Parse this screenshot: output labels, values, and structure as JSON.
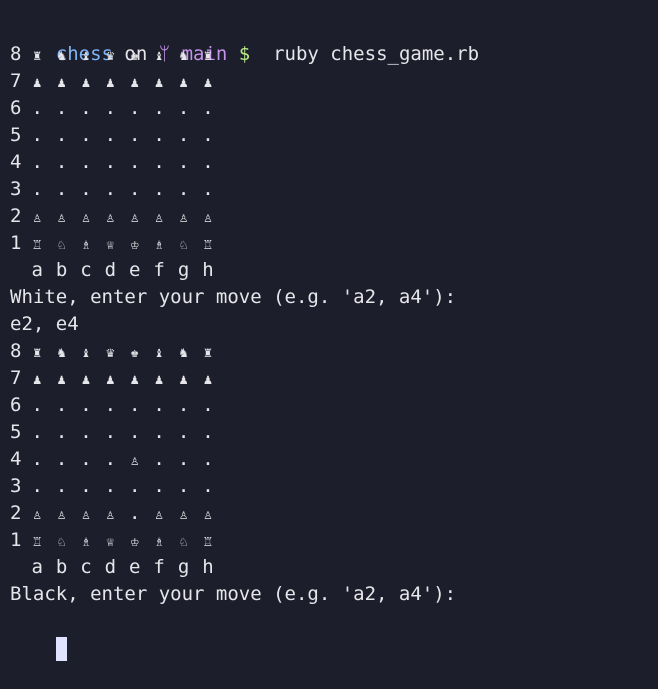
{
  "colors": {
    "background": "#1d1e2c",
    "text": "#e6e6ea",
    "prompt_dir": "#7fb4f5",
    "prompt_branch": "#c792ea",
    "prompt_symbol": "#b8e986",
    "cursor": "#dfe3ff"
  },
  "prompt": {
    "dir": "chess",
    "on": " on ",
    "branch_icon": "ᛘ",
    "branch": " main",
    "symbol": " $",
    "command": "  ruby chess_game.rb"
  },
  "boards": [
    {
      "ranks": [
        {
          "num": "8",
          "squares": [
            "♜",
            "♞",
            "♝",
            "♛",
            "♚",
            "♝",
            "♞",
            "♜"
          ]
        },
        {
          "num": "7",
          "squares": [
            "♟",
            "♟",
            "♟",
            "♟",
            "♟",
            "♟",
            "♟",
            "♟"
          ]
        },
        {
          "num": "6",
          "squares": [
            ".",
            ".",
            ".",
            ".",
            ".",
            ".",
            ".",
            "."
          ]
        },
        {
          "num": "5",
          "squares": [
            ".",
            ".",
            ".",
            ".",
            ".",
            ".",
            ".",
            "."
          ]
        },
        {
          "num": "4",
          "squares": [
            ".",
            ".",
            ".",
            ".",
            ".",
            ".",
            ".",
            "."
          ]
        },
        {
          "num": "3",
          "squares": [
            ".",
            ".",
            ".",
            ".",
            ".",
            ".",
            ".",
            "."
          ]
        },
        {
          "num": "2",
          "squares": [
            "♙",
            "♙",
            "♙",
            "♙",
            "♙",
            "♙",
            "♙",
            "♙"
          ]
        },
        {
          "num": "1",
          "squares": [
            "♖",
            "♘",
            "♗",
            "♕",
            "♔",
            "♗",
            "♘",
            "♖"
          ]
        }
      ],
      "files": [
        "a",
        "b",
        "c",
        "d",
        "e",
        "f",
        "g",
        "h"
      ]
    },
    {
      "ranks": [
        {
          "num": "8",
          "squares": [
            "♜",
            "♞",
            "♝",
            "♛",
            "♚",
            "♝",
            "♞",
            "♜"
          ]
        },
        {
          "num": "7",
          "squares": [
            "♟",
            "♟",
            "♟",
            "♟",
            "♟",
            "♟",
            "♟",
            "♟"
          ]
        },
        {
          "num": "6",
          "squares": [
            ".",
            ".",
            ".",
            ".",
            ".",
            ".",
            ".",
            "."
          ]
        },
        {
          "num": "5",
          "squares": [
            ".",
            ".",
            ".",
            ".",
            ".",
            ".",
            ".",
            "."
          ]
        },
        {
          "num": "4",
          "squares": [
            ".",
            ".",
            ".",
            ".",
            "♙",
            ".",
            ".",
            "."
          ]
        },
        {
          "num": "3",
          "squares": [
            ".",
            ".",
            ".",
            ".",
            ".",
            ".",
            ".",
            "."
          ]
        },
        {
          "num": "2",
          "squares": [
            "♙",
            "♙",
            "♙",
            "♙",
            ".",
            "♙",
            "♙",
            "♙"
          ]
        },
        {
          "num": "1",
          "squares": [
            "♖",
            "♘",
            "♗",
            "♕",
            "♔",
            "♗",
            "♘",
            "♖"
          ]
        }
      ],
      "files": [
        "a",
        "b",
        "c",
        "d",
        "e",
        "f",
        "g",
        "h"
      ]
    }
  ],
  "messages": {
    "white_prompt": "White, enter your move (e.g. 'a2, a4'):",
    "white_input": "e2, e4",
    "black_prompt": "Black, enter your move (e.g. 'a2, a4'):"
  }
}
